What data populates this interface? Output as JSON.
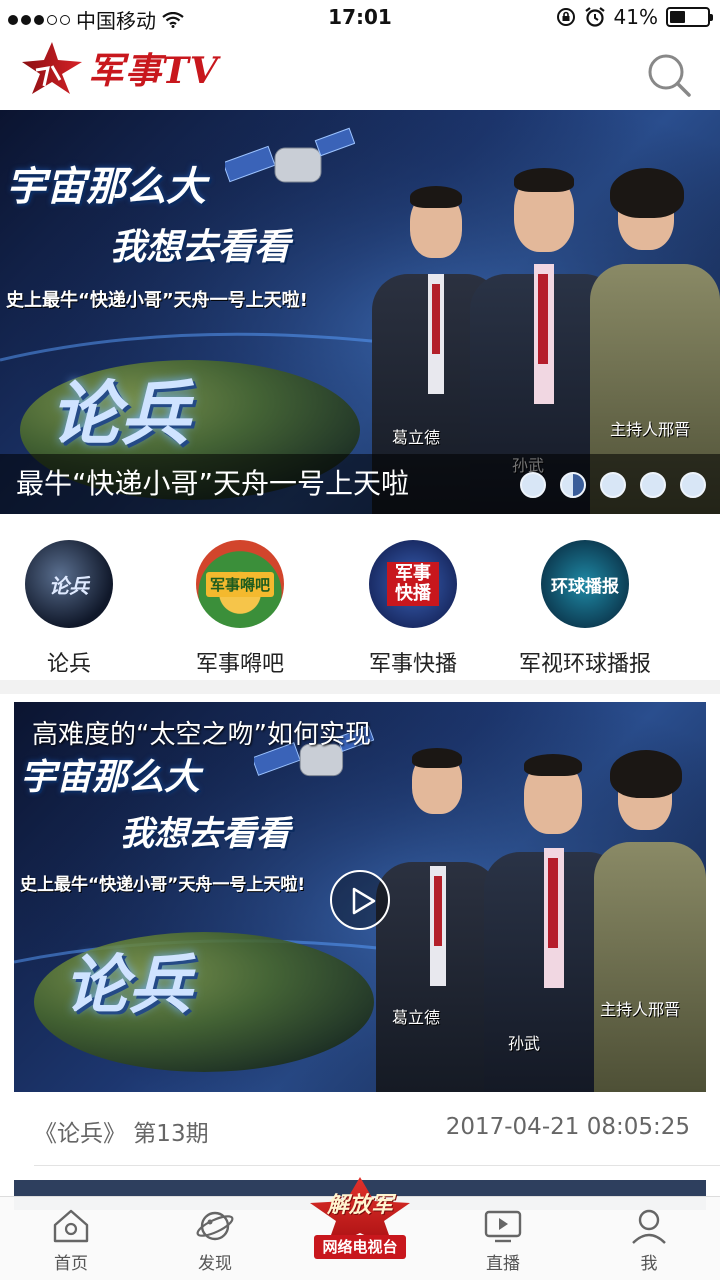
{
  "status_bar": {
    "carrier": "中国移动",
    "time": "17:01",
    "battery_pct_text": "41%",
    "battery_level": 0.41
  },
  "header": {
    "logo_text": "军事TV",
    "logo_icon": "military-star-icon",
    "search_icon": "search-icon"
  },
  "hero": {
    "caption": "最牛“快递小哥”天舟一号上天啦",
    "poster": {
      "title_line1": "宇宙那么大",
      "title_line2": "我想去看看",
      "tagline": "史上最牛“快递小哥”天舟一号上天啦!",
      "show_logo": "论兵",
      "name_left": "葛立德",
      "name_center": "孙武",
      "name_right": "主持人邢晋"
    },
    "page_count": 5,
    "active_page": 2
  },
  "categories": [
    {
      "label": "论兵",
      "icon_text": "论兵",
      "icon": "lunbing-icon"
    },
    {
      "label": "军事嘚吧",
      "icon_text": "军事嘚吧",
      "icon": "junshi-deba-icon"
    },
    {
      "label": "军事快播",
      "icon_text": "军事快播",
      "icon": "junshi-kuaibo-icon"
    },
    {
      "label": "军视环球播报",
      "icon_text": "环球播报",
      "icon": "huanqiu-bobao-icon"
    }
  ],
  "video": {
    "title": "高难度的“太空之吻”如何实现",
    "program": "《论兵》 第13期",
    "datetime": "2017-04-21 08:05:25",
    "poster": {
      "title_line1": "宇宙那么大",
      "title_line2": "我想去看看",
      "tagline": "史上最牛“快递小哥”天舟一号上天啦!",
      "show_logo": "论兵",
      "name_left": "葛立德",
      "name_center": "孙武",
      "name_right": "主持人邢晋"
    }
  },
  "tabbar": {
    "tabs": [
      {
        "label": "首页",
        "icon": "home-icon"
      },
      {
        "label": "发现",
        "icon": "discover-planet-icon"
      },
      {
        "label": "直播",
        "icon": "live-play-icon"
      },
      {
        "label": "我",
        "icon": "user-icon"
      }
    ],
    "center": {
      "line1": "解放军",
      "line2": "网络电视台"
    }
  },
  "colors": {
    "brand_red": "#c8171d",
    "text_gray": "#666666",
    "banner_overlay": "#000000"
  }
}
